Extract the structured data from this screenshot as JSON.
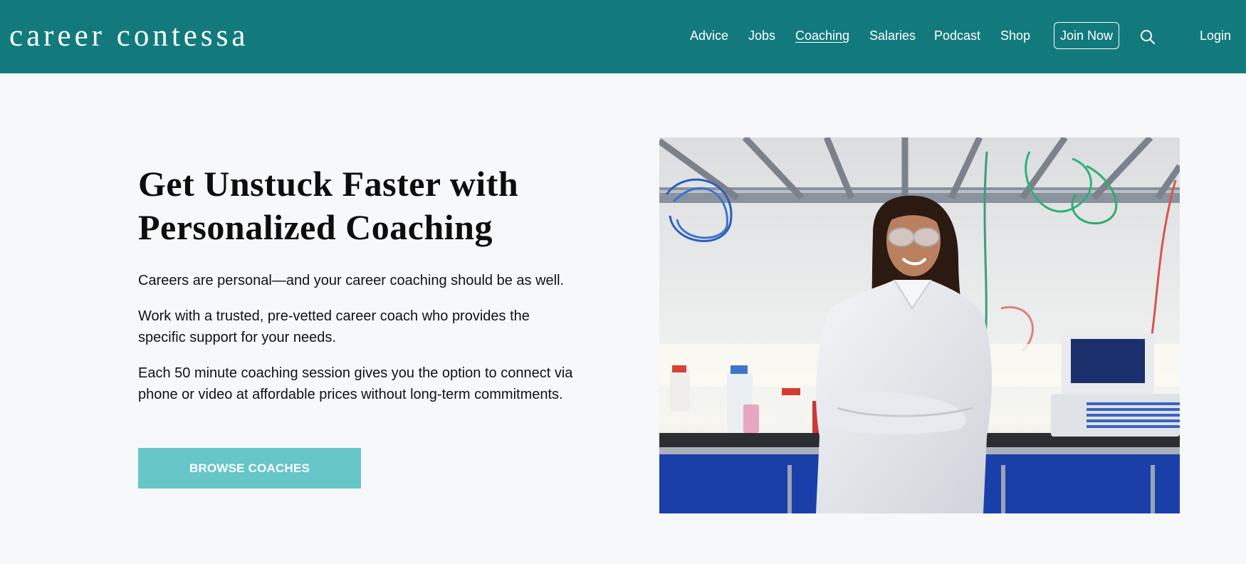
{
  "header": {
    "logo": "career contessa",
    "nav": [
      "Advice",
      "Jobs",
      "Coaching",
      "Salaries",
      "Podcast",
      "Shop"
    ],
    "active_nav": "Coaching",
    "join_label": "Join Now",
    "search_icon": "search-icon",
    "login_label": "Login"
  },
  "hero": {
    "title": "Get Unstuck Faster with Personalized Coaching",
    "paragraphs": [
      "Careers are personal—and your career coaching should be as well.",
      "Work with a trusted, pre-vetted career coach who provides the specific support for your needs.",
      "Each 50 minute coaching session gives you the option to connect via phone or video at affordable prices without long-term commitments."
    ],
    "cta_label": "BROWSE COACHES"
  },
  "colors": {
    "header_bg": "#127a7c",
    "page_bg": "#f7f8fa",
    "cta_bg": "#66c6c8"
  }
}
